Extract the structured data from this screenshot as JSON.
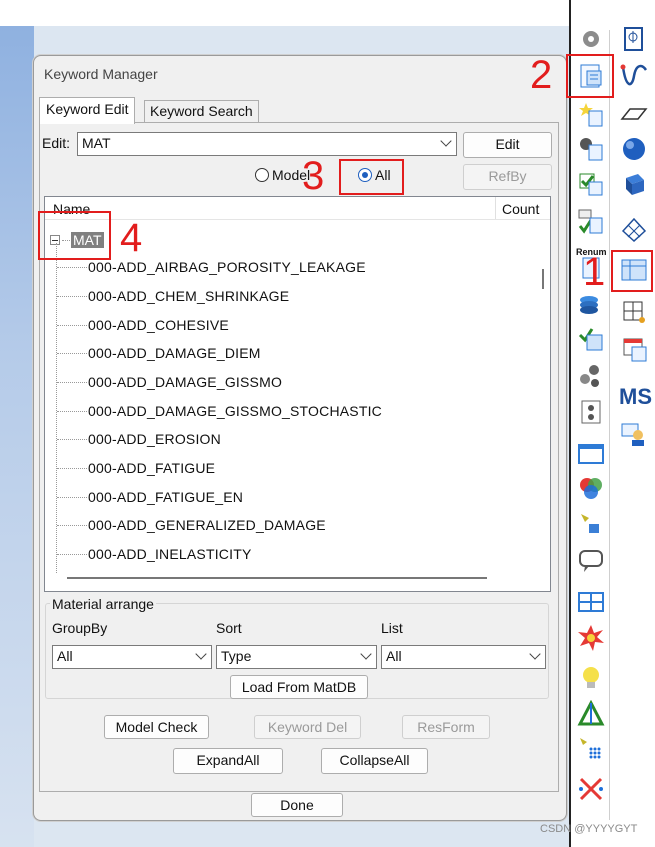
{
  "dialog": {
    "title": "Keyword Manager",
    "tabs": [
      {
        "label": "Keyword Edit",
        "active": true
      },
      {
        "label": "Keyword Search",
        "active": false
      }
    ],
    "edit_label": "Edit:",
    "edit_value": "MAT",
    "edit_button": "Edit",
    "radio_model": "Model",
    "radio_all": "All",
    "radio_selected": "All",
    "refby_button": "RefBy",
    "tree": {
      "columns": [
        "Name",
        "Count"
      ],
      "root": "MAT",
      "items": [
        "000-ADD_AIRBAG_POROSITY_LEAKAGE",
        "000-ADD_CHEM_SHRINKAGE",
        "000-ADD_COHESIVE",
        "000-ADD_DAMAGE_DIEM",
        "000-ADD_DAMAGE_GISSMO",
        "000-ADD_DAMAGE_GISSMO_STOCHASTIC",
        "000-ADD_EROSION",
        "000-ADD_FATIGUE",
        "000-ADD_FATIGUE_EN",
        "000-ADD_GENERALIZED_DAMAGE",
        "000-ADD_INELASTICITY"
      ]
    },
    "material_arrange": {
      "title": "Material arrange",
      "groupby_label": "GroupBy",
      "groupby_value": "All",
      "sort_label": "Sort",
      "sort_value": "Type",
      "list_label": "List",
      "list_value": "All",
      "load_button": "Load From MatDB"
    },
    "buttons": {
      "model_check": "Model Check",
      "keyword_del": "Keyword Del",
      "resform": "ResForm",
      "expand_all": "ExpandAll",
      "collapse_all": "CollapseAll",
      "done": "Done"
    }
  },
  "annotations": [
    "1",
    "2",
    "3",
    "4"
  ],
  "sidebar": {
    "renum_label": "Renum",
    "ms_label": "MS"
  },
  "watermark": "CSDN @YYYYGYT",
  "colors": {
    "highlight": "#e21d1d",
    "selection_gray": "#808080",
    "radio_blue": "#1f5fbf"
  }
}
